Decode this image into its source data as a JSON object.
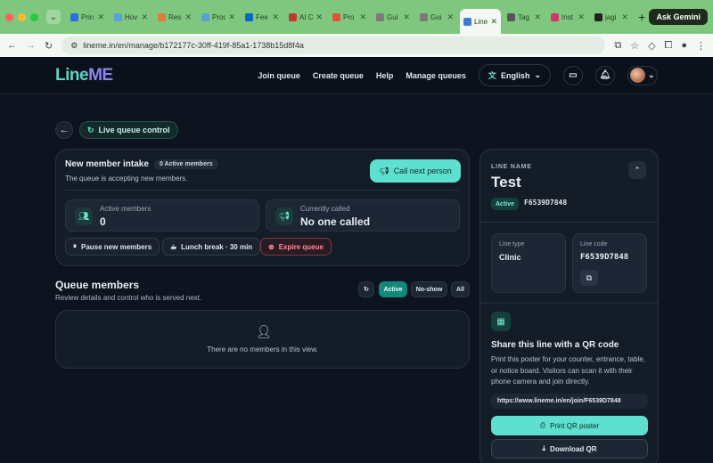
{
  "browser": {
    "tabs": [
      {
        "label": "Prin",
        "fav_color": "#2a6be0"
      },
      {
        "label": "Hov",
        "fav_color": "#5aa0d8"
      },
      {
        "label": "Res",
        "fav_color": "#e07a3a"
      },
      {
        "label": "Prod",
        "fav_color": "#5aa0d8"
      },
      {
        "label": "Fee",
        "fav_color": "#0a66c2"
      },
      {
        "label": "AI C",
        "fav_color": "#c0392b"
      },
      {
        "label": "Pro",
        "fav_color": "#e0533a"
      },
      {
        "label": "Gui",
        "fav_color": "#7a7a7a"
      },
      {
        "label": "Gui",
        "fav_color": "#7a7a7a"
      },
      {
        "label": "Line",
        "fav_color": "#3a7bd5"
      },
      {
        "label": "Tag",
        "fav_color": "#555555"
      },
      {
        "label": "Inst",
        "fav_color": "#d6336c"
      },
      {
        "label": "jagi",
        "fav_color": "#222222"
      }
    ],
    "active_tab_index": 9,
    "url": "lineme.in/en/manage/b172177c-30ff-419f-85a1-1738b15d8f4a",
    "gemini_label": "Ask Gemini"
  },
  "header": {
    "logo_part1": "Line",
    "logo_part2": "ME",
    "nav": [
      "Join queue",
      "Create queue",
      "Help",
      "Manage queues"
    ],
    "language": "English"
  },
  "toolbar": {
    "live_label": "Live queue control"
  },
  "intake": {
    "title": "New member intake",
    "badge": "0 Active members",
    "subtitle": "The queue is accepting new members.",
    "call_button": "Call next person",
    "stats": [
      {
        "label": "Active members",
        "value": "0"
      },
      {
        "label": "Currently called",
        "value": "No one called"
      }
    ],
    "actions": [
      "Pause new members",
      "Lunch break · 30 min",
      "Expire queue"
    ]
  },
  "queue": {
    "title": "Queue members",
    "subtitle": "Review details and control who is served next.",
    "filters": [
      "Active",
      "No-show",
      "All"
    ],
    "active_filter": "Active",
    "empty_text": "There are no members in this view."
  },
  "side": {
    "eyebrow": "LINE NAME",
    "name": "Test",
    "status": "Active",
    "code": "F6539D7848",
    "line_type_label": "Line type",
    "line_type_value": "Clinic",
    "line_code_label": "Line code",
    "line_code_value": "F6539D7848",
    "share_title": "Share this line with a QR code",
    "share_text": "Print this poster for your counter, entrance, table, or notice board. Visitors can scan it with their phone camera and join directly.",
    "join_url": "https://www.lineme.in/en/join/F6539D7848",
    "print_button": "Print QR poster",
    "download_button": "Download QR"
  },
  "colors": {
    "accent": "#5de0cf",
    "page_bg": "#0d1420",
    "chrome_green": "#7fc77f",
    "danger": "#ff8f9a"
  }
}
